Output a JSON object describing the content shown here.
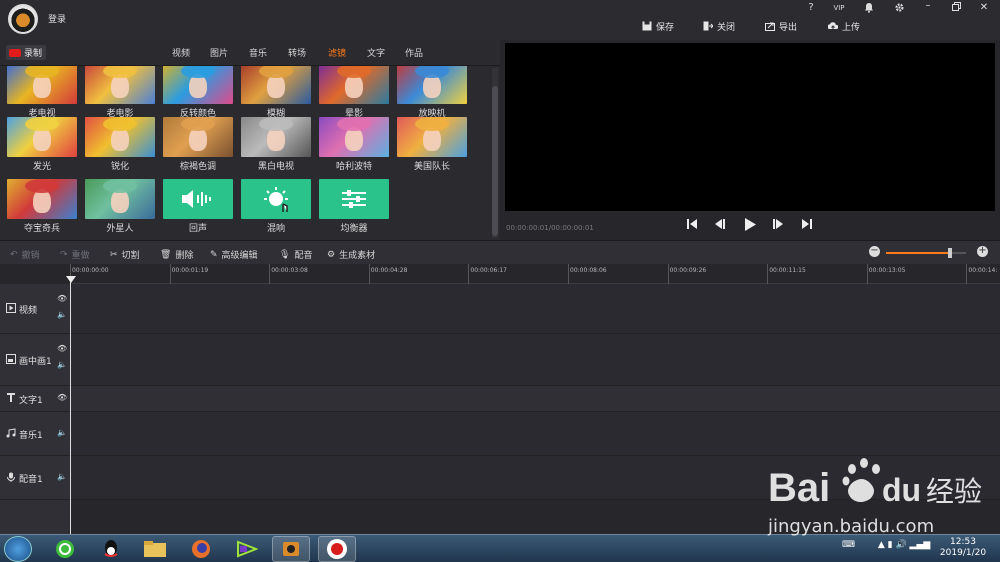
{
  "header": {
    "login": "登录",
    "help": "?",
    "vip": "VIP",
    "actions": [
      {
        "label": "保存",
        "icon": "save-icon"
      },
      {
        "label": "关闭",
        "icon": "exit-icon"
      },
      {
        "label": "导出",
        "icon": "export-icon"
      },
      {
        "label": "上传",
        "icon": "upload-icon"
      }
    ]
  },
  "tabs": {
    "record": "录制",
    "items": [
      "视频",
      "图片",
      "音乐",
      "转场",
      "滤镜",
      "文字",
      "作品"
    ],
    "active": "滤镜"
  },
  "filters": [
    "老电视",
    "老电影",
    "反转颜色",
    "模糊",
    "晕影",
    "放映机",
    "发光",
    "锐化",
    "棕褐色调",
    "黑白电视",
    "哈利波特",
    "美国队长",
    "夺宝奇兵",
    "外星人",
    "回声",
    "混响",
    "均衡器"
  ],
  "preview": {
    "time": "00:00:00:01/00:00:00:01"
  },
  "toolbar": {
    "undo": "撤销",
    "redo": "重做",
    "cut": "切割",
    "delete": "删除",
    "advanced": "高级编辑",
    "dub": "配音",
    "generate": "生成素材"
  },
  "ruler": [
    "00:00:00:00",
    "00:00:01:19",
    "00:00:03:08",
    "00:00:04:28",
    "00:00:06:17",
    "00:00:08:06",
    "00:00:09:26",
    "00:00:11:15",
    "00:00:13:05",
    "00:00:14:"
  ],
  "tracks": [
    {
      "label": "视频",
      "icon": "video-icon"
    },
    {
      "label": "画中画1",
      "icon": "pip-icon"
    },
    {
      "label": "文字1",
      "icon": "text-icon"
    },
    {
      "label": "音乐1",
      "icon": "music-icon"
    },
    {
      "label": "配音1",
      "icon": "mic-icon"
    }
  ],
  "taskbar": {
    "time": "12:53",
    "date": "2019/1/20"
  },
  "watermark": {
    "brand": "Bai du 经验",
    "url": "jingyan.baidu.com"
  },
  "colors": {
    "accent": "#ff7a1a",
    "filter_green": "#2bc38c",
    "record_red": "#e21b1b"
  }
}
